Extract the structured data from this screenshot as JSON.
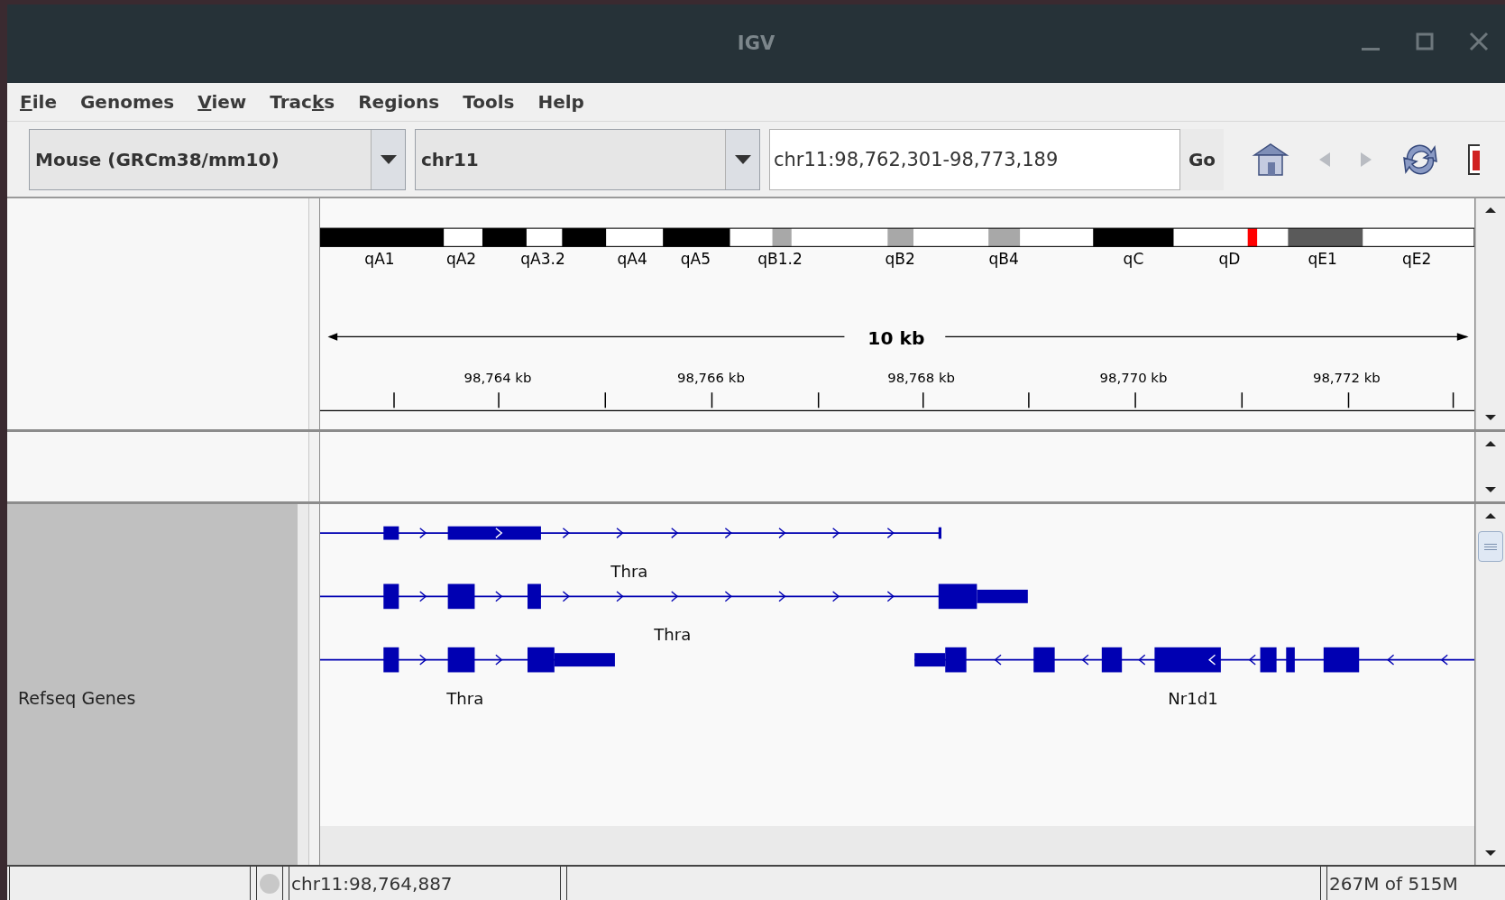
{
  "window": {
    "title": "IGV"
  },
  "menu": [
    {
      "key": "F",
      "post": "ile"
    },
    {
      "pre": "Genomes"
    },
    {
      "key": "V",
      "post": "iew"
    },
    {
      "pre": "Trac",
      "key": "k",
      "post": "s"
    },
    {
      "pre": "Regions"
    },
    {
      "pre": "Tools"
    },
    {
      "pre": "Help"
    }
  ],
  "toolbar": {
    "genome": "Mouse (GRCm38/mm10)",
    "chromosome": "chr11",
    "locus": "chr11:98,762,301-98,773,189",
    "go": "Go"
  },
  "ideogram": {
    "bands": [
      {
        "color": "#000000"
      },
      {
        "color": "#ffffff"
      },
      {
        "color": "#000000"
      },
      {
        "color": "#ffffff"
      },
      {
        "color": "#000000"
      },
      {
        "color": "#ffffff"
      },
      {
        "color": "#000000"
      },
      {
        "color": "#ffffff"
      },
      {
        "color": "#a8a8a8"
      },
      {
        "color": "#ffffff"
      },
      {
        "color": "#a8a8a8"
      },
      {
        "color": "#ffffff"
      },
      {
        "color": "#a8a8a8"
      },
      {
        "color": "#ffffff"
      },
      {
        "color": "#000000"
      },
      {
        "color": "#ffffff"
      },
      {
        "color": "#ff0000"
      },
      {
        "color": "#ffffff"
      },
      {
        "color": "#5a5a5a"
      },
      {
        "color": "#ffffff"
      }
    ],
    "labels": [
      "qA1",
      "qA2",
      "qA3.2",
      "qA4",
      "qA5",
      "qB1.2",
      "qB2",
      "qB4",
      "qC",
      "qD",
      "qE1",
      "qE2"
    ]
  },
  "ruler": {
    "span": "10 kb",
    "ticks": [
      "98,764 kb",
      "98,766 kb",
      "98,768 kb",
      "98,770 kb",
      "98,772 kb"
    ]
  },
  "tracks": [
    {
      "name": "Refseq Genes",
      "genes": [
        "Thra",
        "Thra",
        "Thra",
        "Nr1d1"
      ]
    }
  ],
  "status_bar": {
    "position": "chr11:98,764,887",
    "memory": "267M of 515M"
  }
}
